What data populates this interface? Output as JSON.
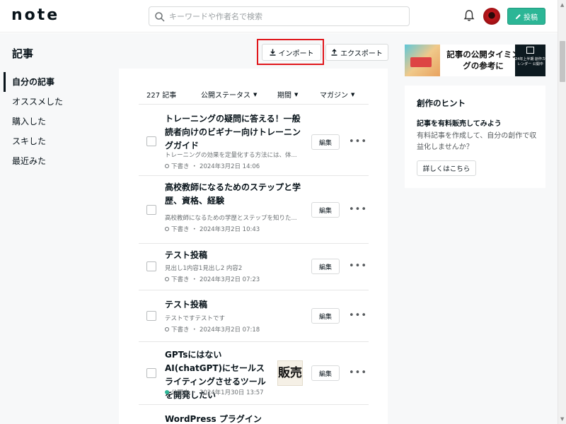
{
  "header": {
    "logo": "note",
    "search_placeholder": "キーワードや作者名で検索",
    "post_label": "投稿"
  },
  "page_title": "記事",
  "sidebar": {
    "items": [
      {
        "label": "自分の記事",
        "active": true
      },
      {
        "label": "オススメした",
        "active": false
      },
      {
        "label": "購入した",
        "active": false
      },
      {
        "label": "スキした",
        "active": false
      },
      {
        "label": "最近みた",
        "active": false
      }
    ]
  },
  "toolbar": {
    "import_label": "インポート",
    "export_label": "エクスポート",
    "highlight_color": "#e0161b"
  },
  "list": {
    "count": "227 記事",
    "filters": [
      "公開ステータス",
      "期間",
      "マガジン"
    ],
    "edit_label": "編集",
    "articles": [
      {
        "title": "トレーニングの疑問に答える！一般読者向けのビギナー向けトレーニングガイド",
        "excerpt": "トレーニングの効果を定量化する方法には、体...",
        "status": "下書き",
        "date": "2024年3月2日 14:06"
      },
      {
        "title": "高校教師になるためのステップと学歴、資格、経験",
        "excerpt": "高校教師になるための学歴とステップを知りた...",
        "status": "下書き",
        "date": "2024年3月2日 10:43"
      },
      {
        "title": "テスト投稿",
        "excerpt": "見出し1内容1見出し2 内容2",
        "status": "下書き",
        "date": "2024年3月2日 07:23"
      },
      {
        "title": "テスト投稿",
        "excerpt": "テストですテストです",
        "status": "下書き",
        "date": "2024年3月2日 07:18"
      },
      {
        "title": "GPTsにはないAI(chatGPT)にセールスライティングさせるツールを開発したい",
        "excerpt": "",
        "status": "公開中",
        "date": "2024年1月30日 13:57",
        "thumb_text": "販売"
      },
      {
        "title": "WordPress プラグイン",
        "excerpt": "",
        "status": "",
        "date": ""
      }
    ]
  },
  "banner": {
    "text": "記事の公開タイミングの参考に",
    "calendar_text": "24年上半期 創作カレンダー 公開中"
  },
  "hint_card": {
    "title": "創作のヒント",
    "subtitle": "記事を有料販売してみよう",
    "body": "有料記事を作成して、自分の創作で収益化しませんか？",
    "button_label": "詳しくはこちら"
  },
  "colors": {
    "accent": "#2cb696",
    "text": "#08131a",
    "background_gray": "#f7f8f9"
  }
}
